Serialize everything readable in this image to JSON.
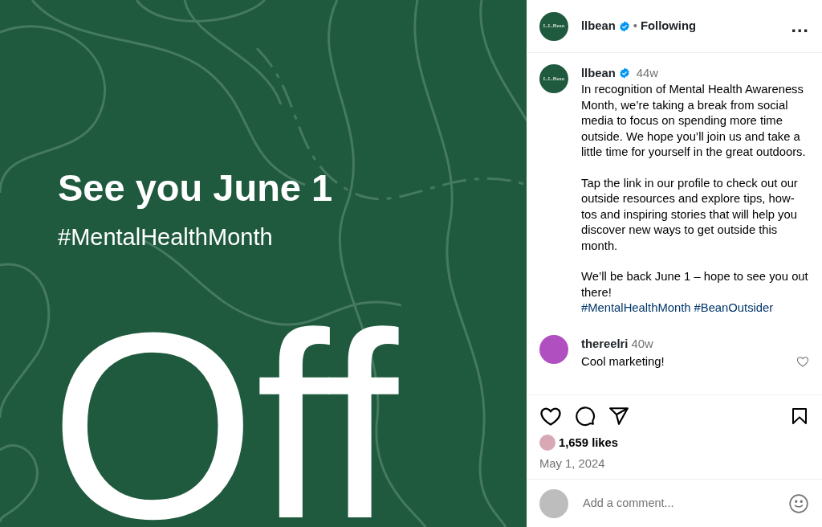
{
  "post_image": {
    "headline": "See you June 1",
    "hashtag": "#MentalHealthMonth",
    "big_text": "Off"
  },
  "header": {
    "logo_text": "L.L.Bean",
    "username": "llbean",
    "verified": true,
    "separator": "•",
    "follow_status": "Following",
    "more": "…"
  },
  "caption": {
    "logo_text": "L.L.Bean",
    "username": "llbean",
    "verified": true,
    "age": "44w",
    "paragraphs": [
      [
        {
          "kind": "text",
          "text": "In recognition of Mental Health Awareness Month, we’re taking a break from social media to focus on spending more time outside. We hope you’ll join us and take a little time for yourself in the great outdoors."
        }
      ],
      [
        {
          "kind": "text",
          "text": "Tap the link in our profile to check out our outside resources and explore tips, how-tos and inspiring stories that will help you discover new ways to get outside this month."
        }
      ],
      [
        {
          "kind": "text",
          "text": "We’ll be back June 1 – hope to see you out there! "
        },
        {
          "kind": "hashtag",
          "text": "#MentalHealthMonth"
        },
        {
          "kind": "hashtag",
          "text": "#BeanOutsider"
        }
      ]
    ]
  },
  "comments": [
    {
      "username": "thereelri",
      "age": "40w",
      "text": "Cool marketing!",
      "liked": false
    }
  ],
  "actions": {
    "liked": false,
    "saved": false
  },
  "likes": "1,659 likes",
  "date": "May 1, 2024",
  "comment_box": {
    "placeholder": "Add a comment..."
  }
}
